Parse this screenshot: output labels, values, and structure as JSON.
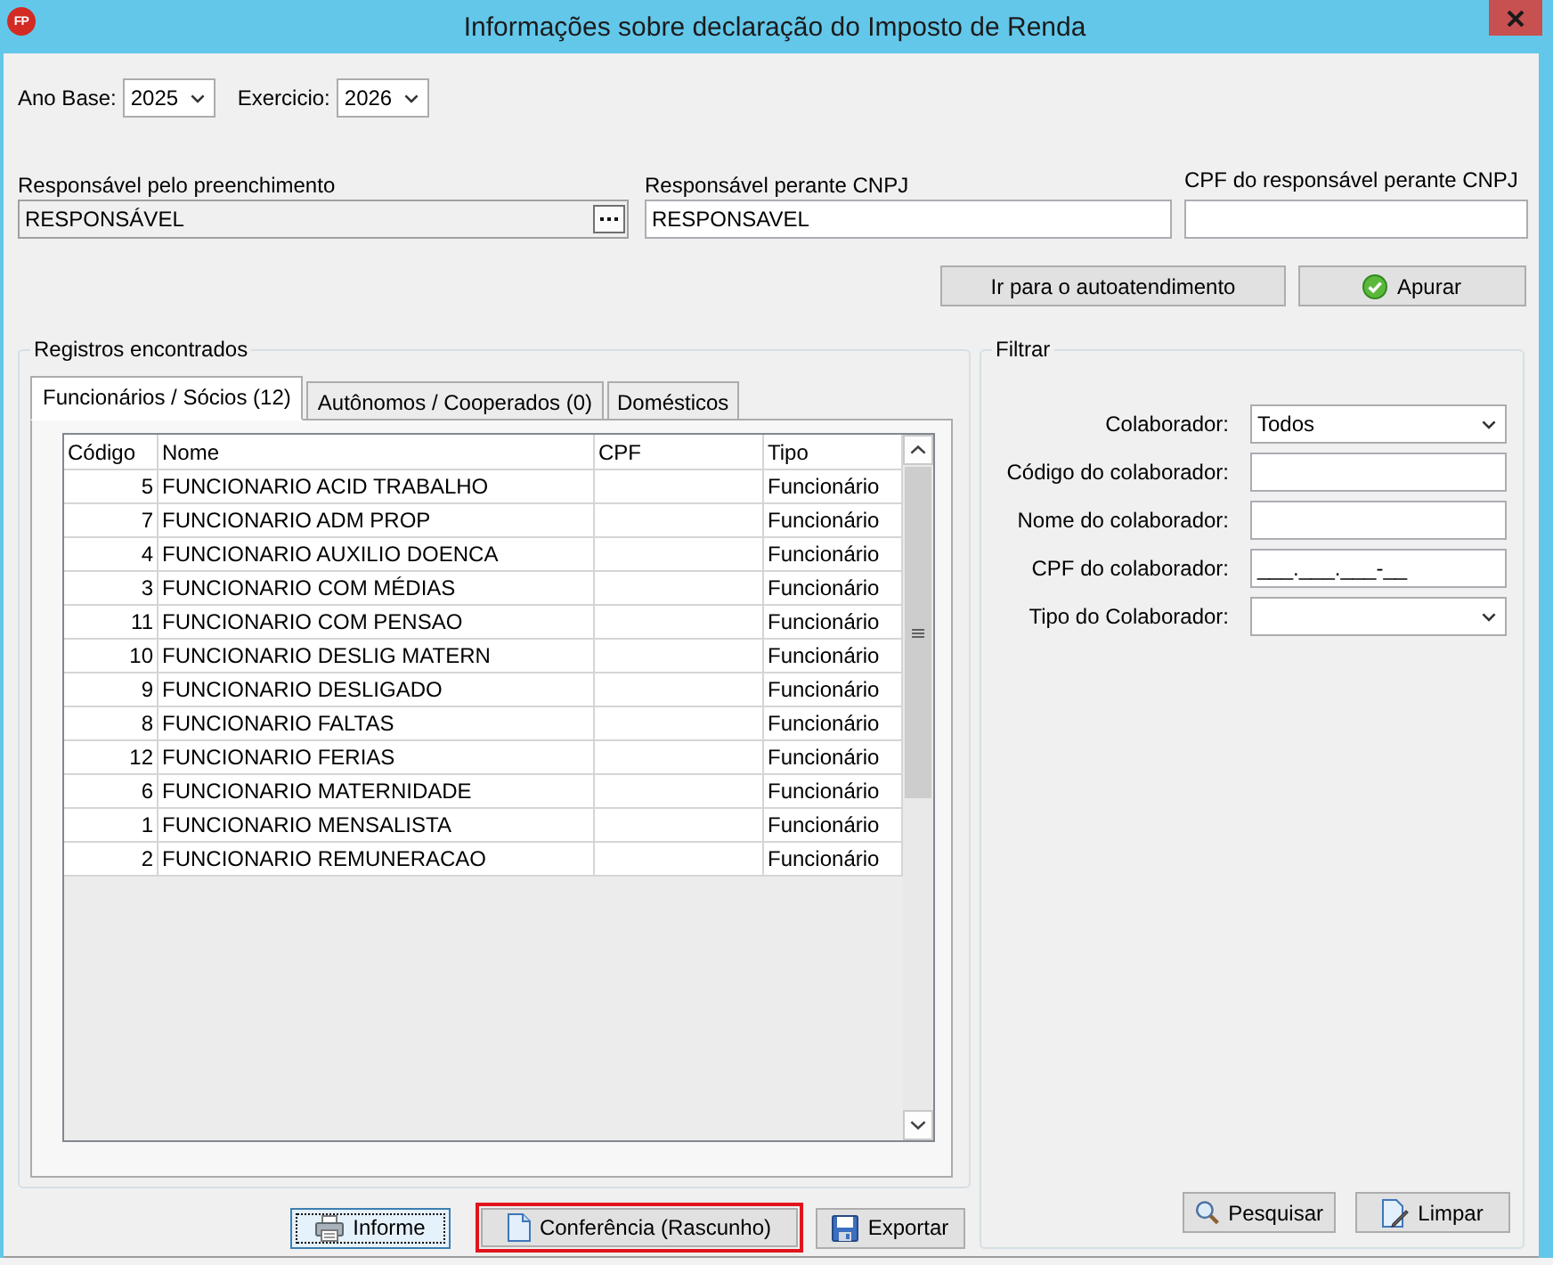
{
  "window": {
    "logo_text": "FP",
    "title": "Informações sobre declaração do Imposto de Renda"
  },
  "year_fields": [
    {
      "label": "Ano Base:",
      "value": "2025"
    },
    {
      "label": "Exercicio:",
      "value": "2026"
    }
  ],
  "responsible_fields": [
    {
      "label": "Responsável pelo preenchimento",
      "value": "RESPONSÁVEL",
      "kind": "lookup",
      "readonly": true
    },
    {
      "label": "Responsável perante CNPJ",
      "value": "RESPONSAVEL",
      "kind": "text",
      "readonly": false
    },
    {
      "label": "CPF do responsável perante CNPJ",
      "kind": "text",
      "readonly": false
    }
  ],
  "self_service_button": {
    "label": "Ir para o autoatendimento"
  },
  "calculate_button": {
    "label": "Apurar"
  },
  "records_group": {
    "title": "Registros encontrados",
    "tabs": [
      {
        "label": "Funcionários / Sócios (12)",
        "selected": true
      },
      {
        "label": "Autônomos / Cooperados (0)",
        "selected": false
      },
      {
        "label": "Domésticos",
        "selected": false
      }
    ],
    "table": {
      "columns": [
        "Código",
        "Nome",
        "CPF",
        "Tipo"
      ],
      "rows": [
        {
          "code": "5",
          "name": "FUNCIONARIO ACID TRABALHO",
          "type": "Funcionário"
        },
        {
          "code": "7",
          "name": "FUNCIONARIO ADM PROP",
          "type": "Funcionário"
        },
        {
          "code": "4",
          "name": "FUNCIONARIO AUXILIO DOENCA",
          "type": "Funcionário"
        },
        {
          "code": "3",
          "name": "FUNCIONARIO COM MÉDIAS",
          "type": "Funcionário"
        },
        {
          "code": "11",
          "name": "FUNCIONARIO COM PENSAO",
          "type": "Funcionário"
        },
        {
          "code": "10",
          "name": "FUNCIONARIO DESLIG MATERN",
          "type": "Funcionário"
        },
        {
          "code": "9",
          "name": "FUNCIONARIO DESLIGADO",
          "type": "Funcionário"
        },
        {
          "code": "8",
          "name": "FUNCIONARIO FALTAS",
          "type": "Funcionário"
        },
        {
          "code": "12",
          "name": "FUNCIONARIO FERIAS",
          "type": "Funcionário"
        },
        {
          "code": "6",
          "name": "FUNCIONARIO MATERNIDADE",
          "type": "Funcionário"
        },
        {
          "code": "1",
          "name": "FUNCIONARIO MENSALISTA",
          "type": "Funcionário"
        },
        {
          "code": "2",
          "name": "FUNCIONARIO REMUNERACAO",
          "type": "Funcionário"
        }
      ]
    }
  },
  "report_button": {
    "label": "Informe",
    "focused": true
  },
  "draft_button": {
    "label": "Conferência (Rascunho)",
    "highlighted": true
  },
  "export_button": {
    "label": "Exportar"
  },
  "filter": {
    "title": "Filtrar",
    "fields": [
      {
        "label": "Colaborador:",
        "kind": "select",
        "value": "Todos"
      },
      {
        "label": "Código do colaborador:",
        "kind": "text"
      },
      {
        "label": "Nome do colaborador:",
        "kind": "text"
      },
      {
        "label": "CPF do colaborador:",
        "kind": "text",
        "value": "___.___.___-__"
      },
      {
        "label": "Tipo do Colaborador:",
        "kind": "select"
      }
    ],
    "search_button": {
      "label": "Pesquisar"
    },
    "clear_button": {
      "label": "Limpar"
    }
  }
}
